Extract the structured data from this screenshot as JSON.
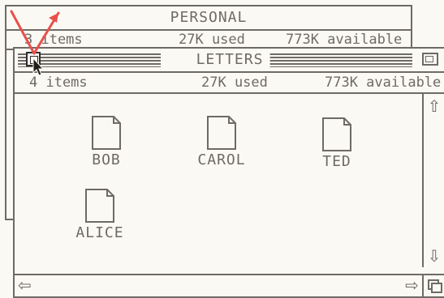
{
  "back_window": {
    "title": "PERSONAL",
    "items": "3 items",
    "used": "27K used",
    "available": "773K available"
  },
  "front_window": {
    "title": "LETTERS",
    "items": "4 items",
    "used": "27K used",
    "available": "773K available"
  },
  "documents": [
    {
      "label": "BOB"
    },
    {
      "label": "CAROL"
    },
    {
      "label": "TED"
    },
    {
      "label": "ALICE"
    }
  ],
  "icons": {
    "close": "close-box-icon",
    "zoom": "zoom-box-icon",
    "scroll_up": "up-arrow-icon",
    "scroll_down": "down-arrow-icon",
    "scroll_left": "left-arrow-icon",
    "scroll_right": "right-arrow-icon",
    "size": "size-box-icon",
    "pointer": "arrow-pointer-icon",
    "annotation": "red-annotation-arrow-icon"
  },
  "colors": {
    "ink": "#6f6a66",
    "paper": "#fbf9f4",
    "annotation": "#e8504a"
  }
}
